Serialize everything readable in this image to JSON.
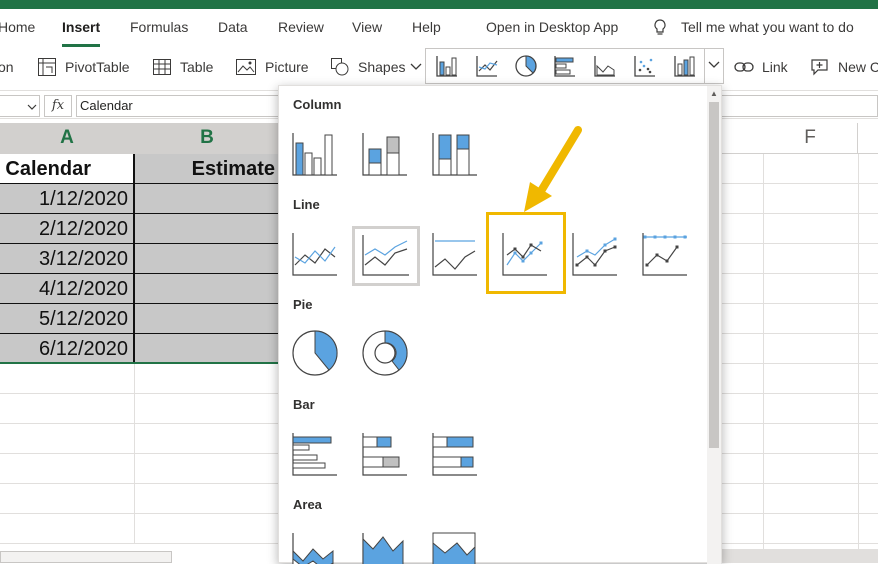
{
  "tabs": [
    "Home",
    "Insert",
    "Formulas",
    "Data",
    "Review",
    "View",
    "Help"
  ],
  "open_desktop": "Open in Desktop App",
  "tell_me": "Tell me what you want to do",
  "ribbon": {
    "on_partial": "on",
    "pivottable": "PivotTable",
    "table": "Table",
    "picture": "Picture",
    "shapes": "Shapes",
    "link": "Link",
    "new_comment_partial": "New C"
  },
  "formula": {
    "fx": "fx",
    "value": "Calendar"
  },
  "columns": [
    "A",
    "B",
    "F"
  ],
  "sheet": {
    "headers": [
      "Calendar",
      "Estimate"
    ],
    "rows": [
      "1/12/2020",
      "2/12/2020",
      "3/12/2020",
      "4/12/2020",
      "5/12/2020",
      "6/12/2020"
    ]
  },
  "chart_menu": {
    "sections": [
      "Column",
      "Line",
      "Pie",
      "Bar",
      "Area"
    ]
  },
  "colors": {
    "excel_green": "#217346",
    "highlight": "#f0b800",
    "chart_blue": "#5ba3e0"
  }
}
